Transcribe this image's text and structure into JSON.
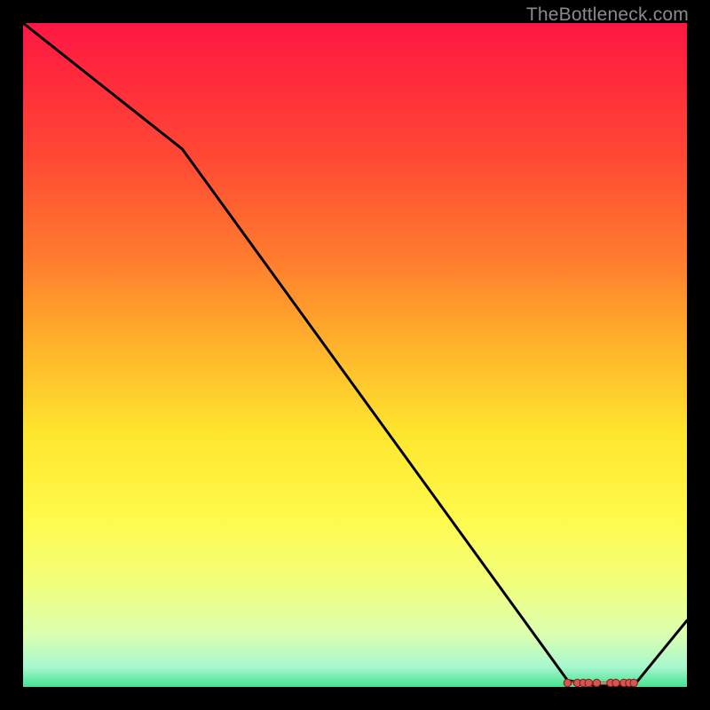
{
  "attribution": "TheBottleneck.com",
  "chart_data": {
    "type": "line",
    "title": "",
    "xlabel": "",
    "ylabel": "",
    "xlim": [
      0,
      100
    ],
    "ylim": [
      0,
      100
    ],
    "x": [
      0,
      24,
      82,
      86,
      92,
      100
    ],
    "values": [
      100,
      81,
      1,
      0.2,
      0.2,
      10
    ],
    "flat_region_x": [
      82,
      92
    ],
    "gradient_stops": [
      {
        "offset": 0.0,
        "color": "#ff1744"
      },
      {
        "offset": 0.08,
        "color": "#ff2a3c"
      },
      {
        "offset": 0.2,
        "color": "#ff4834"
      },
      {
        "offset": 0.35,
        "color": "#ff7a2e"
      },
      {
        "offset": 0.5,
        "color": "#ffb82c"
      },
      {
        "offset": 0.62,
        "color": "#ffe62e"
      },
      {
        "offset": 0.74,
        "color": "#fff94a"
      },
      {
        "offset": 0.84,
        "color": "#f3ff7a"
      },
      {
        "offset": 0.92,
        "color": "#dcffb0"
      },
      {
        "offset": 0.97,
        "color": "#a8f7cf"
      },
      {
        "offset": 1.0,
        "color": "#45e28f"
      }
    ],
    "marker_xs": [
      82,
      83.5,
      84.4,
      85.2,
      86.4,
      88.5,
      89.3,
      90.5,
      91.3,
      92
    ]
  }
}
